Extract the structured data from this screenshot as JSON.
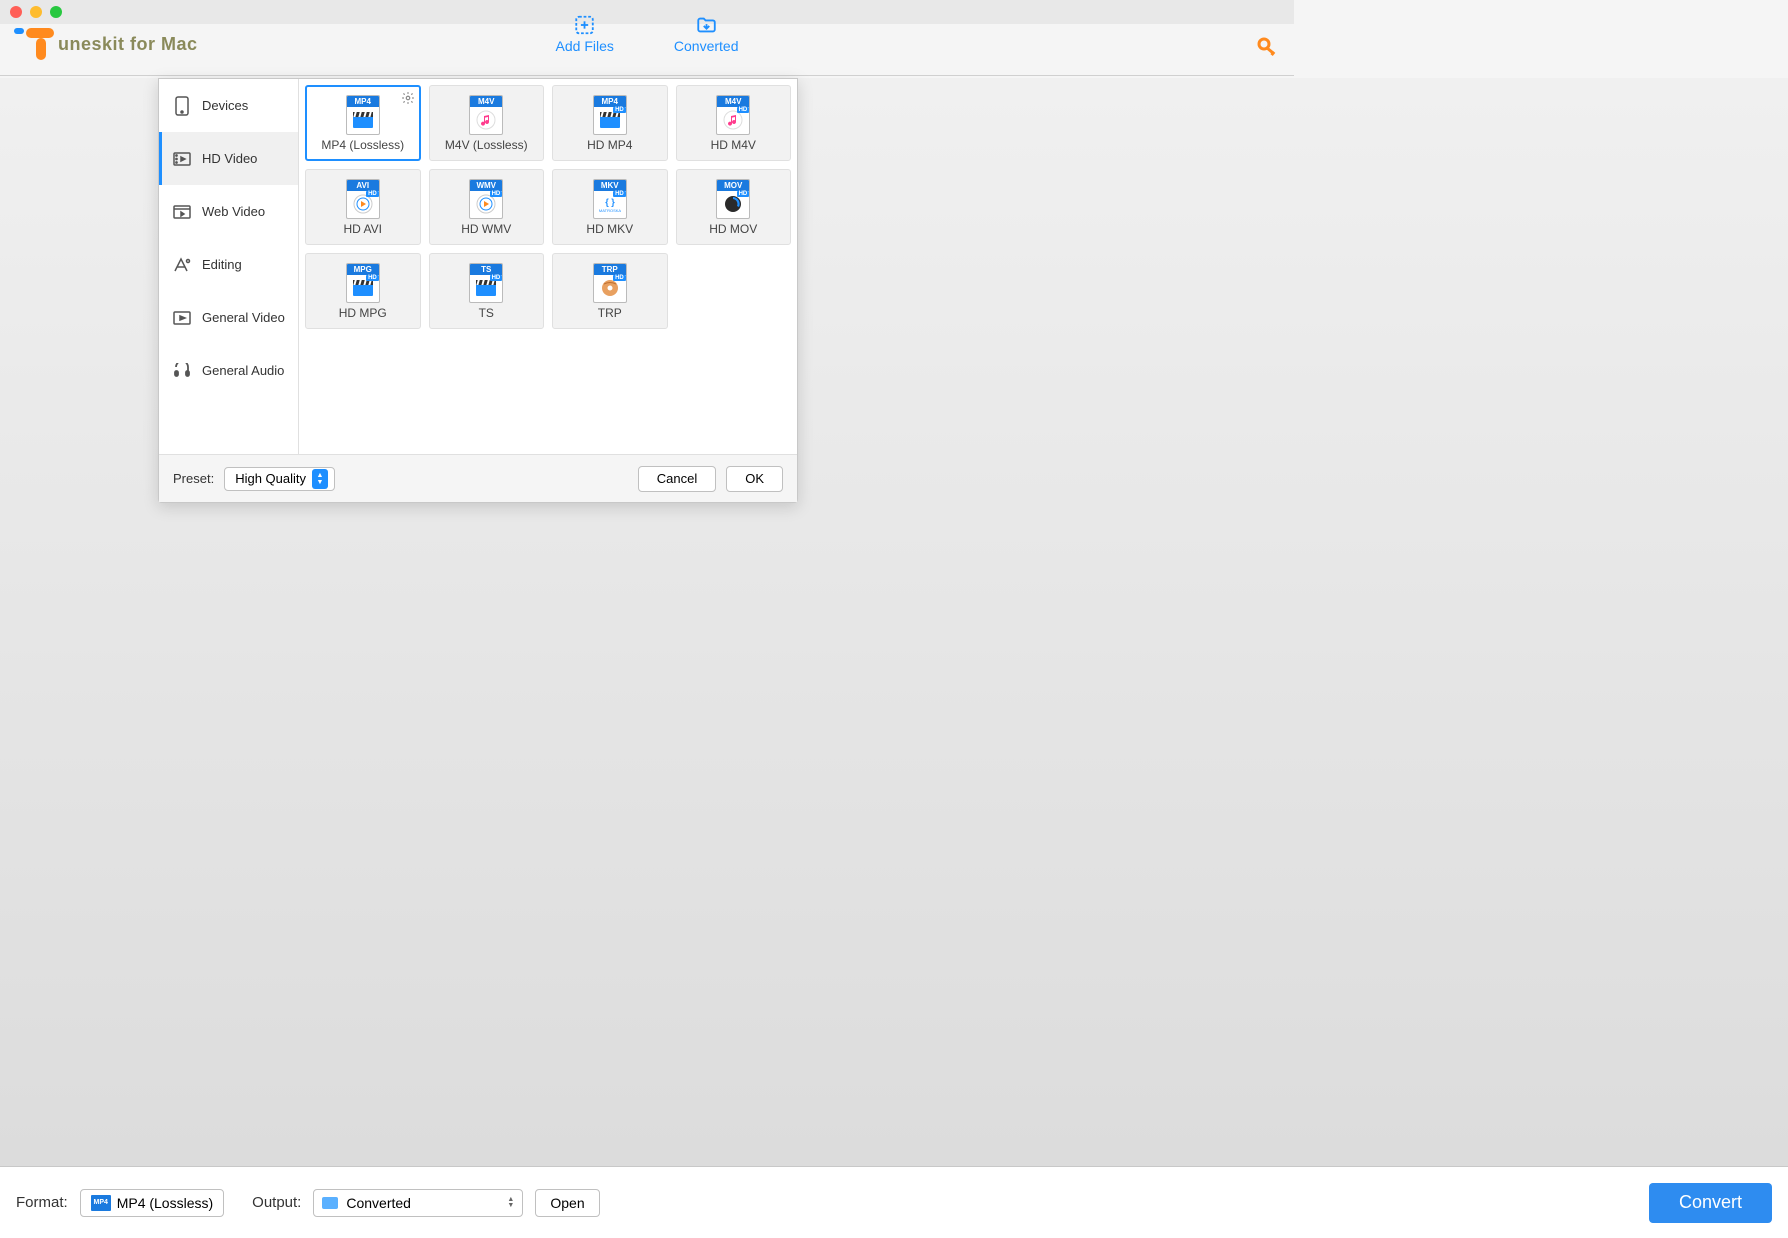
{
  "app_name": "uneskit for Mac",
  "header": {
    "add_files": "Add Files",
    "converted": "Converted"
  },
  "dialog": {
    "sidebar": [
      {
        "label": "Devices",
        "icon": "device"
      },
      {
        "label": "HD Video",
        "icon": "hdvideo",
        "active": true
      },
      {
        "label": "Web Video",
        "icon": "webvideo"
      },
      {
        "label": "Editing",
        "icon": "editing"
      },
      {
        "label": "General Video",
        "icon": "genvideo"
      },
      {
        "label": "General Audio",
        "icon": "genaudio"
      }
    ],
    "formats": [
      {
        "ext": "MP4",
        "label": "MP4 (Lossless)",
        "body": "clapper",
        "selected": true,
        "gear": true
      },
      {
        "ext": "M4V",
        "label": "M4V (Lossless)",
        "body": "music"
      },
      {
        "ext": "MP4",
        "label": "HD MP4",
        "body": "clapper",
        "hd": true
      },
      {
        "ext": "M4V",
        "label": "HD M4V",
        "body": "music",
        "hd": true
      },
      {
        "ext": "AVI",
        "label": "HD AVI",
        "body": "wmp",
        "hd": true
      },
      {
        "ext": "WMV",
        "label": "HD WMV",
        "body": "wmp",
        "hd": true
      },
      {
        "ext": "MKV",
        "label": "HD MKV",
        "body": "mkv",
        "hd": true
      },
      {
        "ext": "MOV",
        "label": "HD MOV",
        "body": "qt",
        "hd": true
      },
      {
        "ext": "MPG",
        "label": "HD MPG",
        "body": "clapper",
        "hd": true
      },
      {
        "ext": "TS",
        "label": "TS",
        "body": "clapper",
        "hd": true
      },
      {
        "ext": "TRP",
        "label": "TRP",
        "body": "disc",
        "hd": true
      }
    ],
    "preset_label": "Preset:",
    "preset_value": "High Quality",
    "cancel": "Cancel",
    "ok": "OK"
  },
  "bottom": {
    "format_label": "Format:",
    "format_value": "MP4 (Lossless)",
    "format_ext": "MP4",
    "output_label": "Output:",
    "output_value": "Converted",
    "open": "Open",
    "convert": "Convert"
  }
}
